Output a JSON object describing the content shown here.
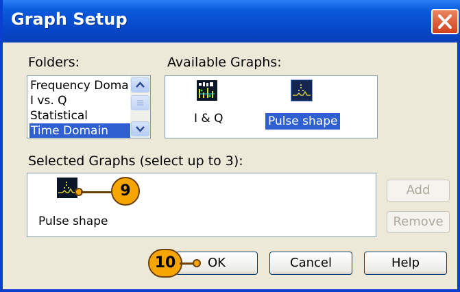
{
  "window": {
    "title": "Graph Setup",
    "close_icon": "close-icon"
  },
  "colors": {
    "titlebar": "#0a5bdc",
    "selection": "#2f5fd0",
    "callout": "#f7a500",
    "close": "#d2401e"
  },
  "folders": {
    "label": "Folders:",
    "items": [
      "Frequency Doma",
      "I vs. Q",
      "Statistical",
      "Time Domain"
    ],
    "selected": "Time Domain"
  },
  "available": {
    "label": "Available Graphs:",
    "graphs": [
      {
        "label": "I & Q",
        "icon": "iq-graph-icon"
      },
      {
        "label": "Pulse shape",
        "icon": "pulse-shape-graph-icon",
        "selected": true
      }
    ]
  },
  "selected": {
    "label": "Selected Graphs (select up to 3):",
    "graphs": [
      {
        "label": "Pulse shape",
        "icon": "pulse-shape-graph-icon"
      }
    ]
  },
  "buttons": {
    "add": "Add",
    "remove": "Remove",
    "ok": "OK",
    "cancel": "Cancel",
    "help": "Help"
  },
  "callouts": {
    "c9": "9",
    "c10": "10"
  }
}
